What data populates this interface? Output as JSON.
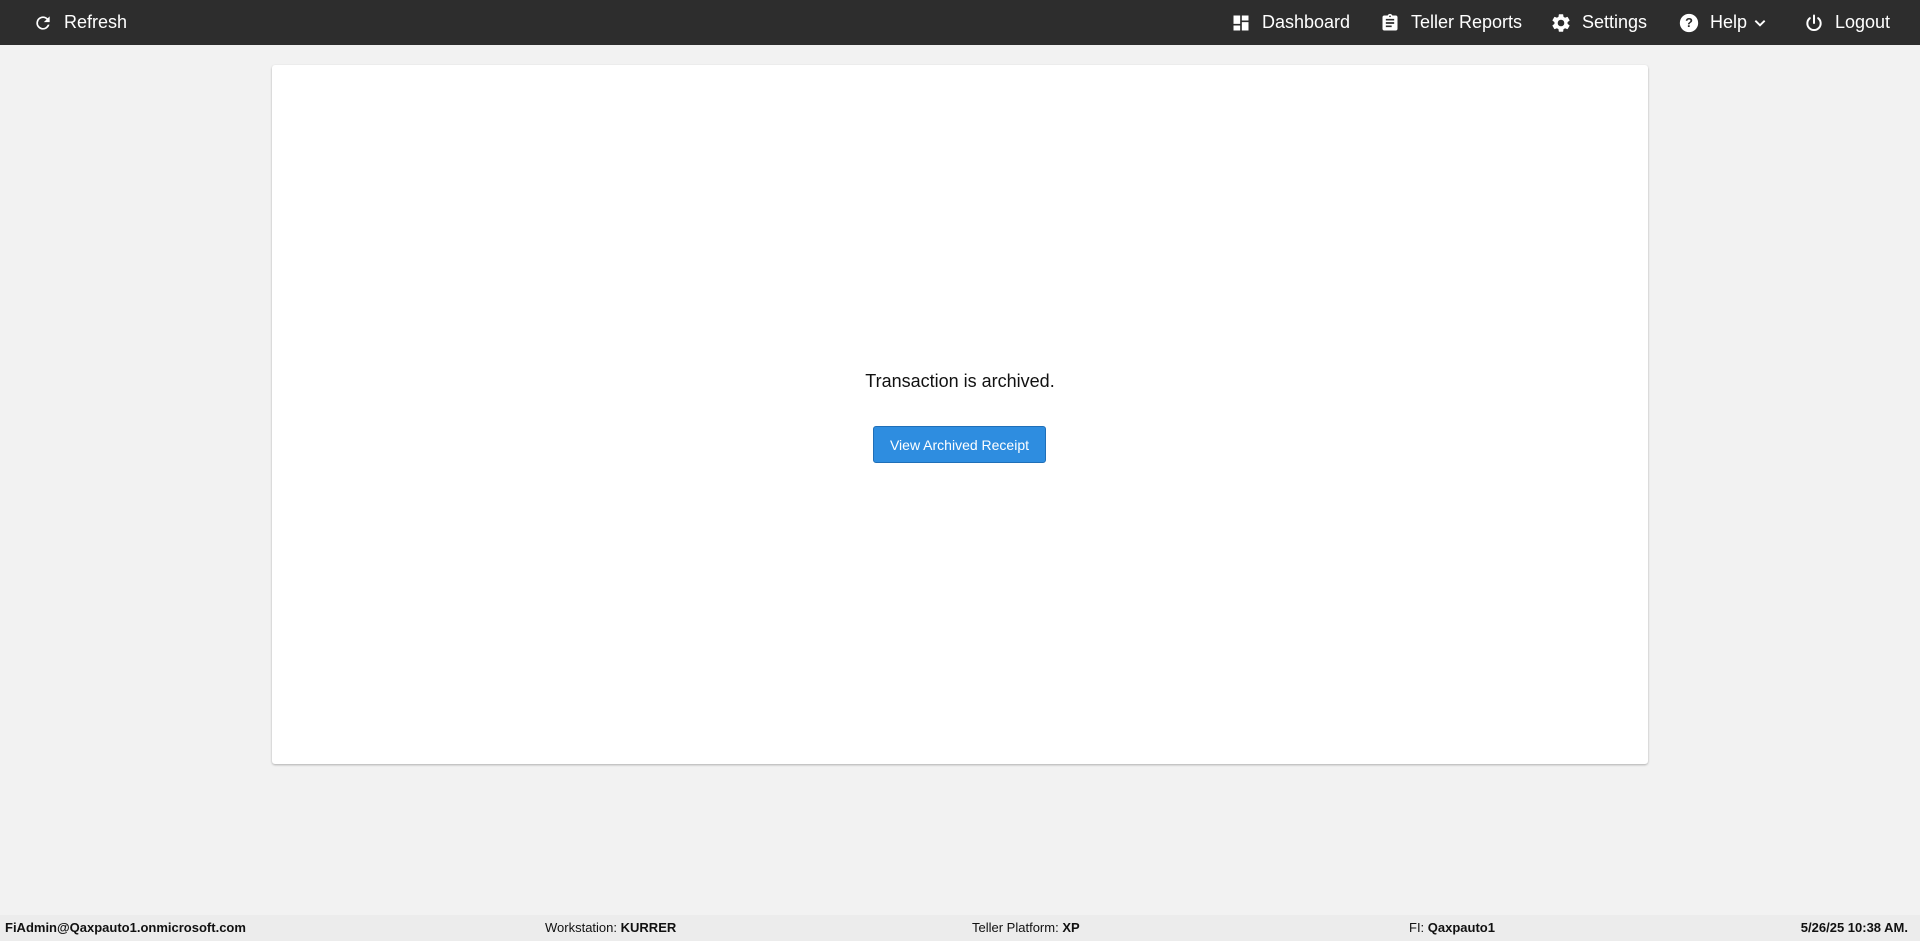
{
  "topbar": {
    "refresh_label": "Refresh",
    "dashboard_label": "Dashboard",
    "teller_reports_label": "Teller Reports",
    "settings_label": "Settings",
    "help_label": "Help",
    "logout_label": "Logout"
  },
  "main": {
    "message": "Transaction is archived.",
    "view_receipt_label": "View Archived Receipt"
  },
  "statusbar": {
    "user": "FiAdmin@Qaxpauto1.onmicrosoft.com",
    "workstation_label": "Workstation:",
    "workstation_value": "KURRER",
    "platform_label": "Teller Platform:",
    "platform_value": "XP",
    "fi_label": "FI:",
    "fi_value": "Qaxpauto1",
    "datetime": "5/26/25 10:38 AM."
  },
  "colors": {
    "topbar_bg": "#2d2d2d",
    "page_bg": "#f2f2f2",
    "button_bg": "#2e8de0"
  },
  "icons": [
    "refresh-icon",
    "dashboard-icon",
    "clipboard-icon",
    "gear-icon",
    "help-icon",
    "chevron-down-icon",
    "power-icon"
  ]
}
